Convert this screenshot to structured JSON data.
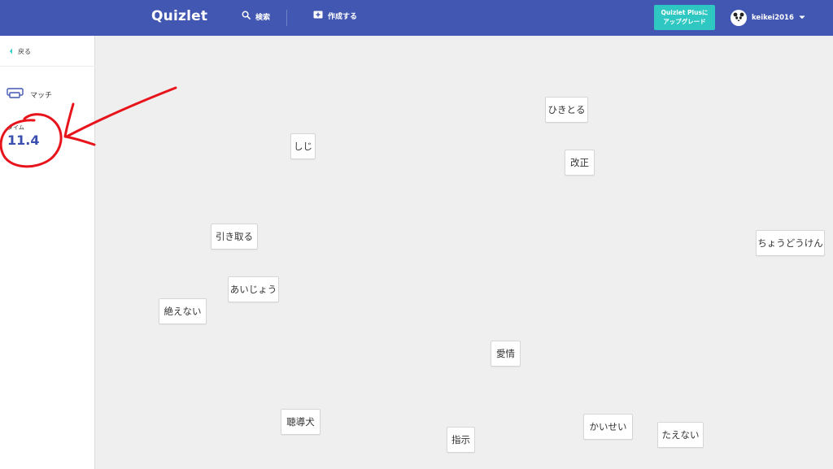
{
  "header": {
    "logo": "Quizlet",
    "search_label": "検索",
    "create_label": "作成する",
    "plus_line1": "Quizlet Plusに",
    "plus_line2": "アップグレード",
    "username": "keikei2016"
  },
  "sidebar": {
    "back_label": "戻る",
    "mode_label": "マッチ",
    "time_label": "タイム",
    "time_value": "11.4"
  },
  "tiles": [
    "ひきとる",
    "しじ",
    "改正",
    "引き取る",
    "ちょうどうけん",
    "あいじょう",
    "絶えない",
    "愛情",
    "聴導犬",
    "指示",
    "かいせい",
    "たえない"
  ],
  "colors": {
    "topbar": "#4257b2",
    "accent_teal": "#2fc7c1",
    "time_value": "#3b4fb0",
    "annotation": "#e8141c"
  }
}
